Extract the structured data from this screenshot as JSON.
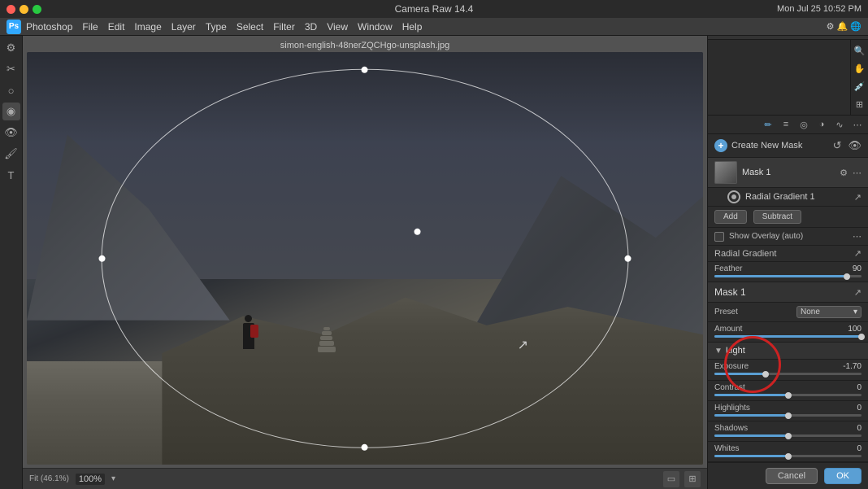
{
  "app": {
    "title": "Camera Raw 14.4",
    "file_name": "simon-english-48nerZQCHgo-unsplash.jpg",
    "ps_label": "Ps"
  },
  "menu": {
    "items": [
      "Photoshop",
      "File",
      "Edit",
      "Image",
      "Layer",
      "Type",
      "Select",
      "Filter",
      "3D",
      "View",
      "Window",
      "Help"
    ]
  },
  "canvas": {
    "fit_label": "Fit (46.1%)",
    "zoom": "100%"
  },
  "right_panel": {
    "create_mask_label": "Create New Mask",
    "mask1_label": "Mask 1",
    "radial_gradient_label": "Radial Gradient 1",
    "add_label": "Add",
    "subtract_label": "Subtract",
    "show_overlay_label": "Show Overlay (auto)",
    "radial_gradient_section_label": "Radial Gradient",
    "feather_label": "Feather",
    "feather_value": "90",
    "mask1_section_label": "Mask 1",
    "preset_label": "Preset",
    "preset_value": "None",
    "amount_label": "Amount",
    "amount_value": "100",
    "light_label": "Light",
    "exposure_label": "Exposure",
    "exposure_value": "-1.70",
    "contrast_label": "Contrast",
    "contrast_value": "0",
    "highlights_label": "Highlights",
    "highlights_value": "0",
    "shadows_label": "Shadows",
    "shadows_value": "0",
    "whites_label": "Whites",
    "whites_value": "0",
    "cancel_label": "Cancel",
    "ok_label": "OK"
  },
  "sliders": {
    "feather_pct": 90,
    "amount_pct": 100,
    "exposure_pct": 35,
    "contrast_pct": 50,
    "highlights_pct": 50,
    "shadows_pct": 50,
    "whites_pct": 50
  }
}
